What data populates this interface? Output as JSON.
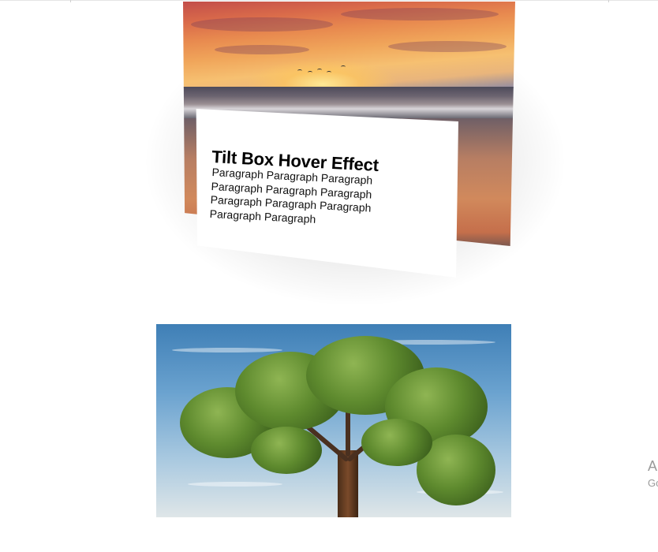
{
  "card": {
    "title": "Tilt Box Hover Effect",
    "paragraph": "Paragraph Paragraph Paragraph Paragraph Paragraph Paragraph Paragraph Paragraph Paragraph Paragraph Paragraph"
  },
  "images": {
    "top": "sunset-beach-photo",
    "bottom": "tree-photo"
  },
  "ad_fragment": {
    "letter": "A",
    "sub": "Go"
  },
  "colors": {
    "background": "#ffffff",
    "title": "#000000",
    "ad_text": "#9a9a9a"
  }
}
